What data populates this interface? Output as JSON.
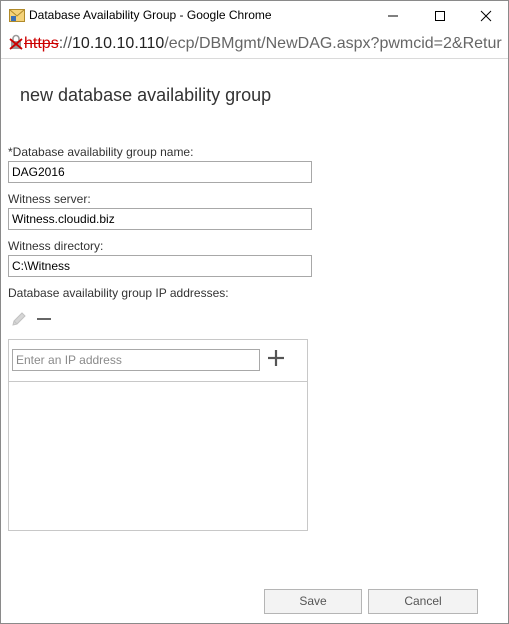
{
  "window": {
    "title": "Database Availability Group - Google Chrome",
    "controls": [
      "minimize",
      "maximize",
      "close"
    ]
  },
  "address_bar": {
    "scheme": "https",
    "separator": "://",
    "host": "10.10.10.110",
    "path": "/ecp/DBMgmt/NewDAG.aspx?pwmcid=2&Retur",
    "security_state": "not-secure"
  },
  "form": {
    "heading": "new database availability group",
    "name_label": "*Database availability group name:",
    "name_value": "DAG2016",
    "witness_server_label": "Witness server:",
    "witness_server_value": "Witness.cloudid.biz",
    "witness_directory_label": "Witness directory:",
    "witness_directory_value": "C:\\Witness",
    "ip_label": "Database availability group IP addresses:",
    "ip_placeholder": "Enter an IP address",
    "ip_addresses": []
  },
  "buttons": {
    "save": "Save",
    "cancel": "Cancel"
  },
  "icons": {
    "window": "exchange-window-icon",
    "security": "not-secure-lock-icon",
    "edit": "pencil-icon",
    "remove": "minus-icon",
    "add": "plus-icon"
  }
}
